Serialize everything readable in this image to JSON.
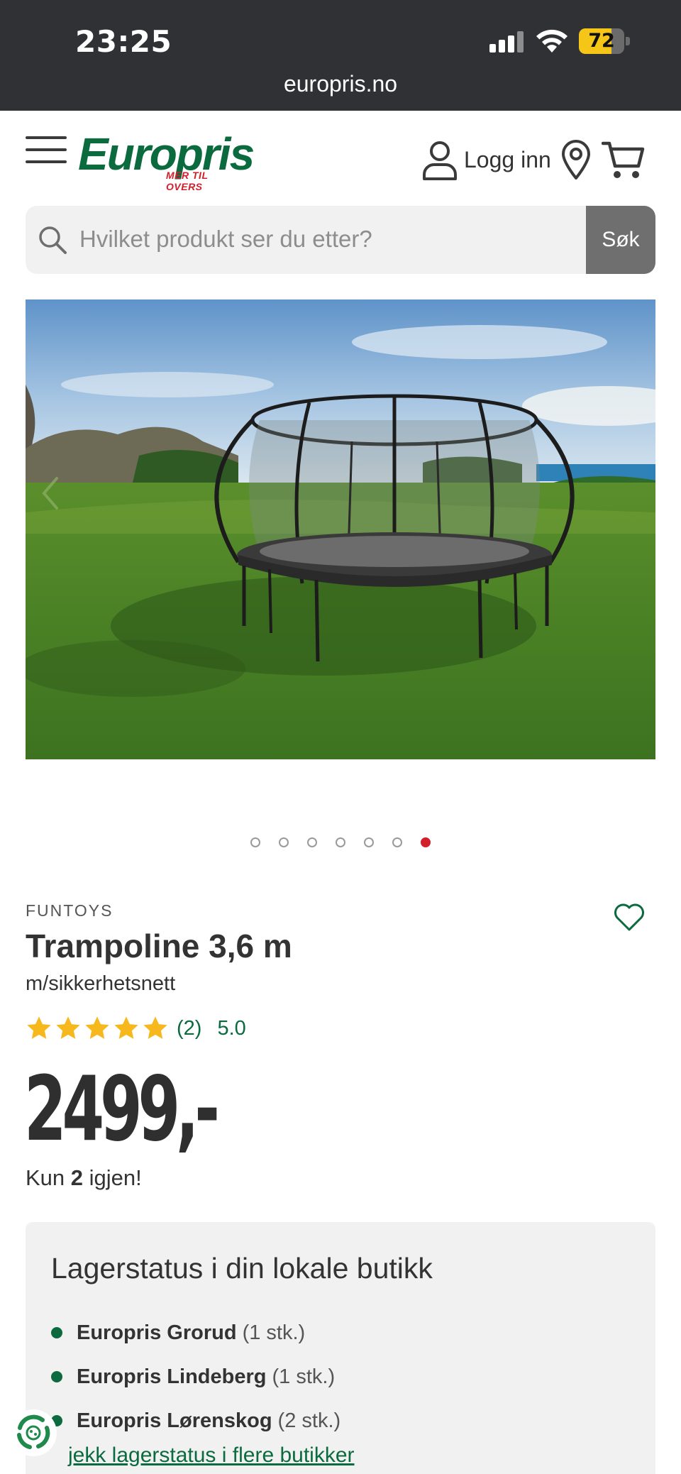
{
  "status_bar": {
    "time": "23:25",
    "battery": "72",
    "battery_level": 0.72,
    "url": "europris.no",
    "battery_color": "#f5c518"
  },
  "header": {
    "logo_main": "Europris",
    "logo_tagline": "MER TIL OVERS",
    "login_label": "Logg inn",
    "icons": [
      "hamburger-menu-icon",
      "user-icon",
      "location-pin-icon",
      "cart-icon"
    ],
    "brand_green": "#0b6b3f",
    "brand_red": "#d21f2b"
  },
  "search": {
    "placeholder": "Hvilket produkt ser du etter?",
    "button_label": "Søk"
  },
  "gallery": {
    "slide_count": 7,
    "active_index": 6
  },
  "product": {
    "brand": "FUNTOYS",
    "title": "Trampoline 3,6 m",
    "subtitle": "m/sikkerhetsnett",
    "stars": 5,
    "review_count": "(2)",
    "score": "5.0",
    "price": "2499,-",
    "stock_prefix": "Kun ",
    "stock_count": "2",
    "stock_suffix": " igjen!"
  },
  "stores": {
    "heading": "Lagerstatus i din lokale butikk",
    "items": [
      {
        "name": "Europris Grorud",
        "qty": "(1 stk.)"
      },
      {
        "name": "Europris Lindeberg",
        "qty": "(1 stk.)"
      },
      {
        "name": "Europris Lørenskog",
        "qty": "(2 stk.)"
      }
    ],
    "more_link": "jekk lagerstatus i flere butikker"
  }
}
